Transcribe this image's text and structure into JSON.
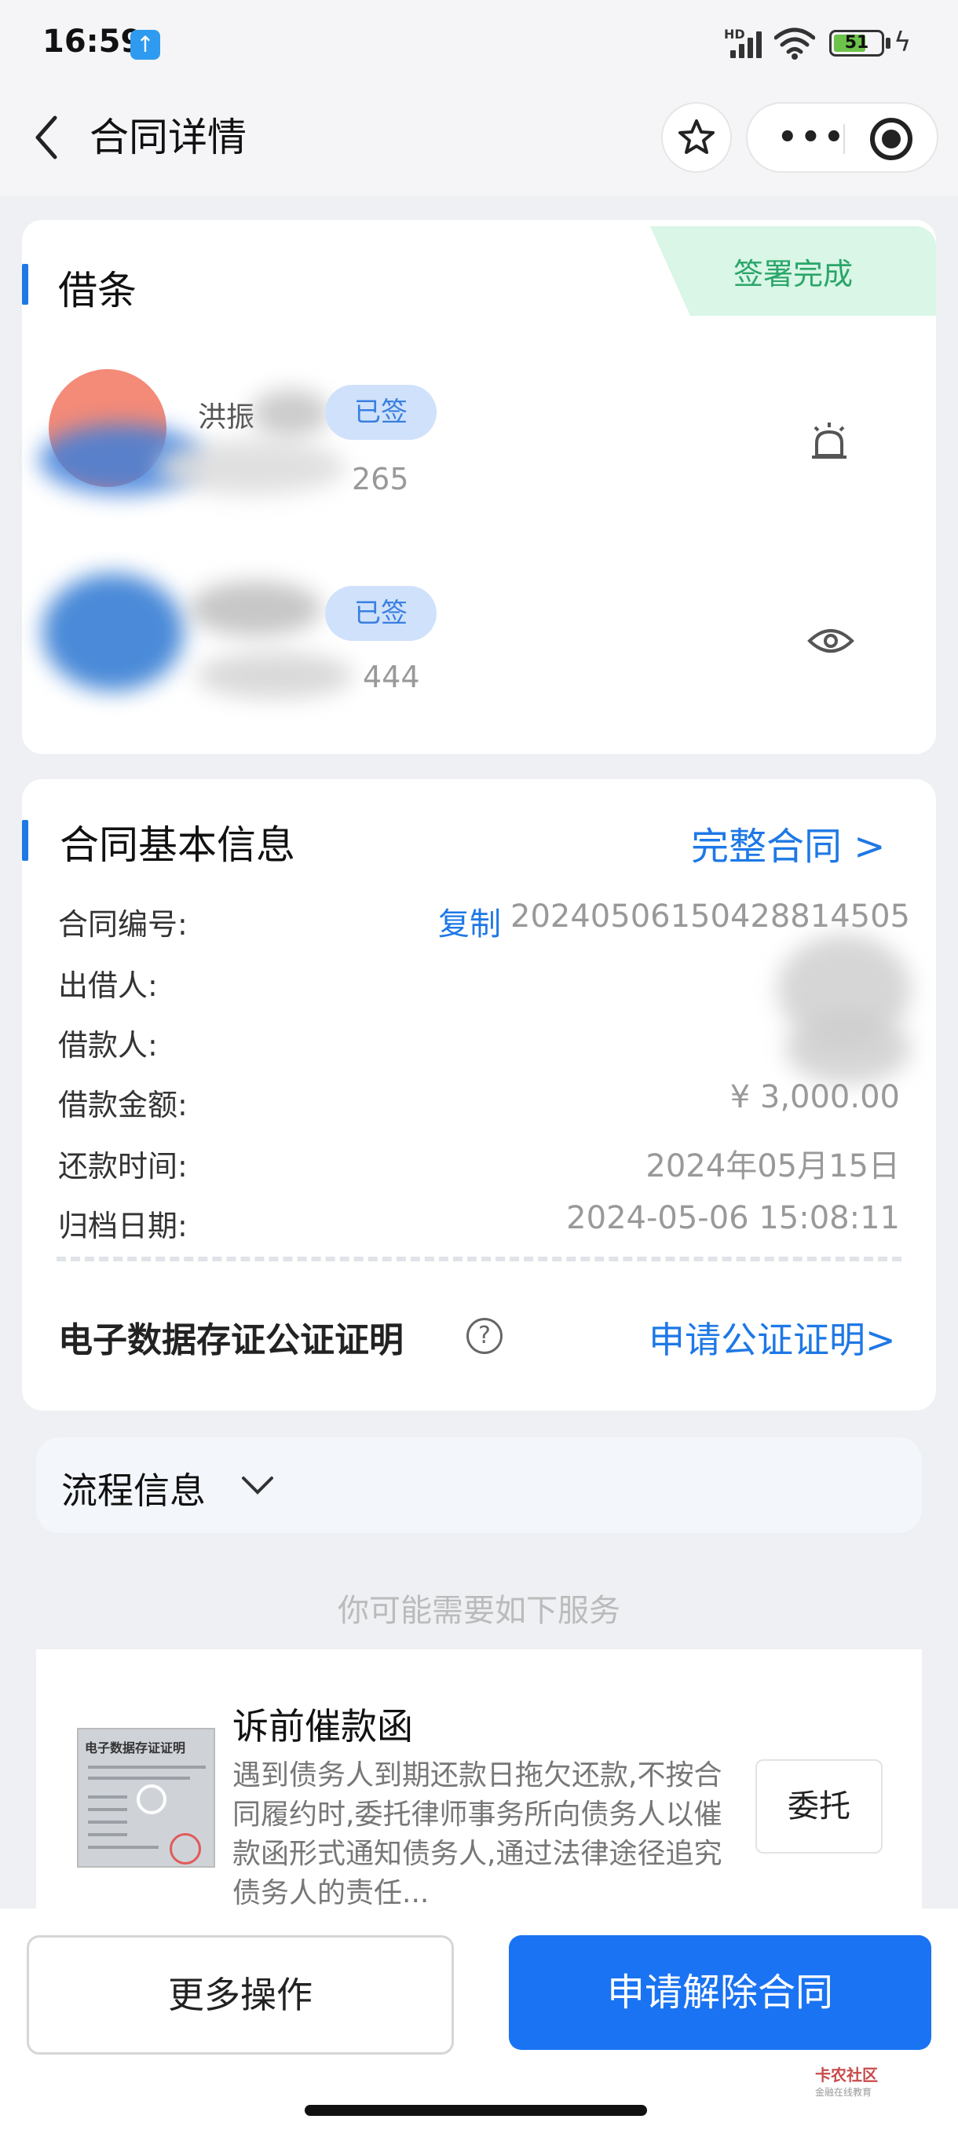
{
  "status": {
    "time": "16:59",
    "battery": "51",
    "network": "HD"
  },
  "nav": {
    "title": "合同详情"
  },
  "signers_card": {
    "title": "借条",
    "status_tag": "签署完成",
    "signers": [
      {
        "name": "洪振",
        "badge": "已签",
        "phone": "265"
      },
      {
        "name": "",
        "badge": "已签",
        "phone": "444"
      }
    ]
  },
  "basic_info": {
    "title": "合同基本信息",
    "full_contract_link": "完整合同 >",
    "rows": [
      {
        "label": "合同编号:",
        "value": "20240506150428814505",
        "action": "复制"
      },
      {
        "label": "出借人:",
        "value": ""
      },
      {
        "label": "借款人:",
        "value": ""
      },
      {
        "label": "借款金额:",
        "value": "¥ 3,000.00"
      },
      {
        "label": "还款时间:",
        "value": "2024年05月15日"
      },
      {
        "label": "归档日期:",
        "value": "2024-05-06 15:08:11"
      }
    ],
    "notary_title": "电子数据存证公证证明",
    "notary_help": "?",
    "notary_link": "申请公证证明>"
  },
  "flow": {
    "title": "流程信息"
  },
  "hint": "你可能需要如下服务",
  "service": {
    "title": "诉前催款函",
    "description": "遇到债务人到期还款日拖欠还款,不按合同履约时,委托律师事务所向债务人以催款函形式通知债务人,通过法律途径追究债务人的责任...",
    "thumb_title": "电子数据存证证明",
    "button": "委托"
  },
  "bottom": {
    "more": "更多操作",
    "cancel": "申请解除合同"
  },
  "watermark": {
    "main": "卡农社区",
    "sub": "金融在线教育"
  },
  "colors": {
    "accent": "#1e78e6",
    "primary_button": "#1a73f2",
    "done_tag_bg": "#d9f6e6",
    "done_tag_text": "#2aa66a"
  }
}
